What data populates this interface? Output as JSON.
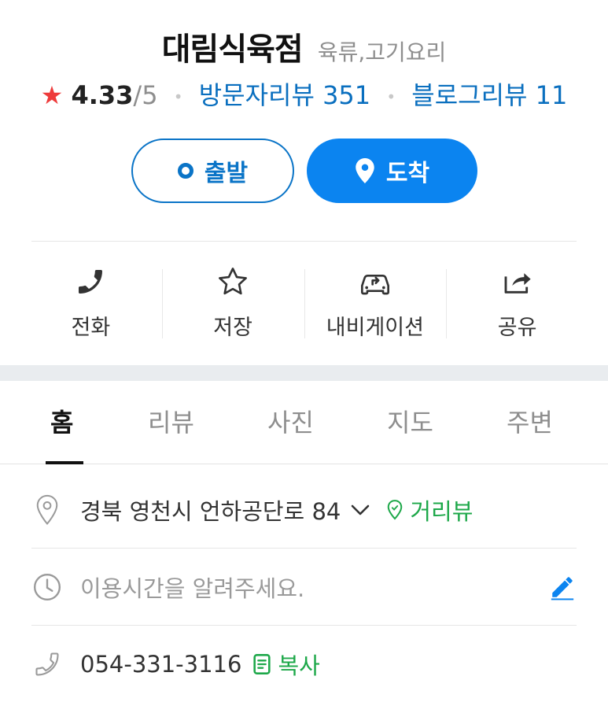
{
  "place": {
    "name": "대림식육점",
    "category": "육류,고기요리"
  },
  "stats": {
    "rating": "4.33",
    "rating_max": "/5",
    "visitor_reviews": "방문자리뷰 351",
    "blog_reviews": "블로그리뷰 11",
    "separator": "•"
  },
  "route": {
    "depart_label": "출발",
    "arrive_label": "도착"
  },
  "actions": [
    {
      "label": "전화",
      "icon": "phone-icon"
    },
    {
      "label": "저장",
      "icon": "star-outline-icon"
    },
    {
      "label": "내비게이션",
      "icon": "car-navigation-icon"
    },
    {
      "label": "공유",
      "icon": "share-icon"
    }
  ],
  "tabs": [
    {
      "label": "홈",
      "active": true
    },
    {
      "label": "리뷰",
      "active": false
    },
    {
      "label": "사진",
      "active": false
    },
    {
      "label": "지도",
      "active": false
    },
    {
      "label": "주변",
      "active": false
    }
  ],
  "info": {
    "address": "경북 영천시 언하공단로 84",
    "street_view": "거리뷰",
    "hours_placeholder": "이용시간을 알려주세요.",
    "phone": "054-331-3116",
    "copy": "복사"
  },
  "colors": {
    "accent_blue": "#0b84f0",
    "link_blue": "#0a6fbf",
    "star_red": "#ee3b3b",
    "green": "#1ea84a"
  }
}
